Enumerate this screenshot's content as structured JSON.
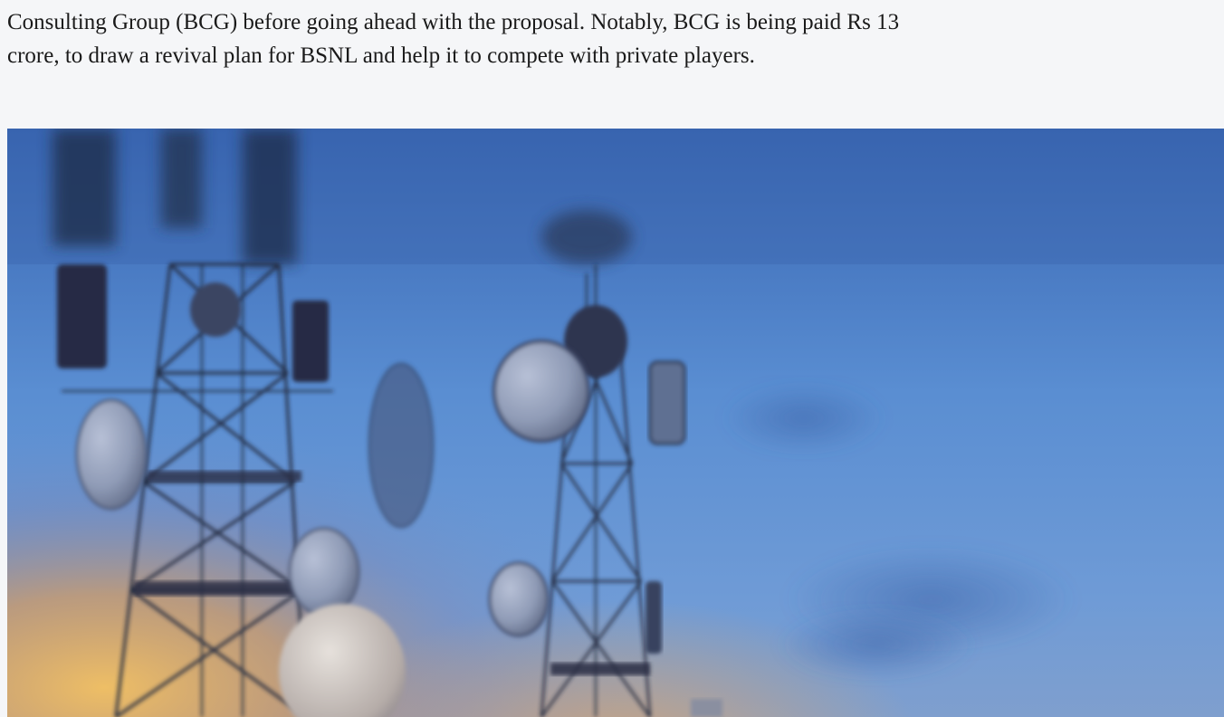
{
  "article": {
    "paragraph_lines": [
      "Consulting Group (BCG) before going ahead with the proposal. Notably, BCG is being paid Rs 13",
      "crore, to draw a revival plan for BSNL and help it to compete with private players."
    ]
  },
  "image": {
    "subject": "telecom-towers-at-dusk",
    "colors": {
      "sky_top": "#3a6fb8",
      "sky_mid": "#5b8fd0",
      "sky_low": "#7aa3d8",
      "dusk_glow": "#f0b24a",
      "tower": "#2a2f45",
      "dish": "#9aa6bf"
    }
  }
}
